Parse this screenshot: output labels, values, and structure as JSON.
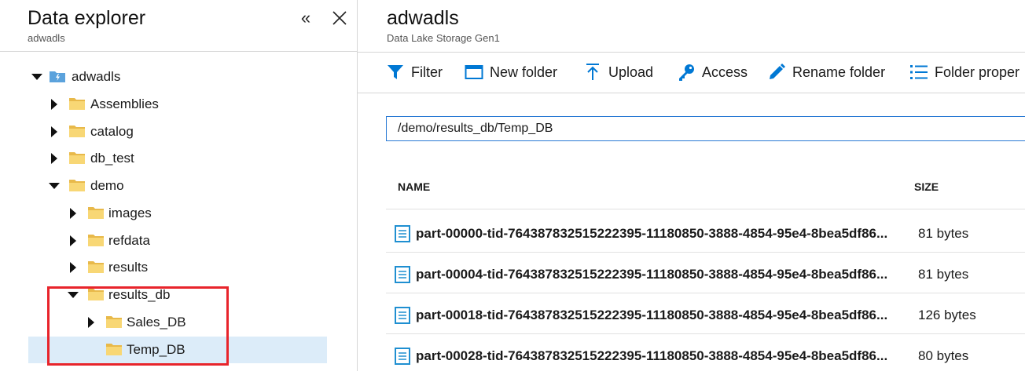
{
  "explorer": {
    "title": "Data explorer",
    "subtitle": "adwadls",
    "collapse_glyph": "«",
    "close_glyph": "✕",
    "tree": [
      {
        "label": "adwadls",
        "icon": "storage-account-icon",
        "state": "expanded"
      },
      {
        "label": "Assemblies",
        "icon": "folder-icon",
        "state": "collapsed"
      },
      {
        "label": "catalog",
        "icon": "folder-icon",
        "state": "collapsed"
      },
      {
        "label": "db_test",
        "icon": "folder-icon",
        "state": "collapsed"
      },
      {
        "label": "demo",
        "icon": "folder-icon",
        "state": "expanded"
      },
      {
        "label": "images",
        "icon": "folder-icon",
        "state": "collapsed"
      },
      {
        "label": "refdata",
        "icon": "folder-icon",
        "state": "collapsed"
      },
      {
        "label": "results",
        "icon": "folder-icon",
        "state": "collapsed"
      },
      {
        "label": "results_db",
        "icon": "folder-icon",
        "state": "expanded"
      },
      {
        "label": "Sales_DB",
        "icon": "folder-icon",
        "state": "collapsed"
      },
      {
        "label": "Temp_DB",
        "icon": "folder-icon",
        "state": "leaf",
        "selected": true
      }
    ]
  },
  "main": {
    "title": "adwadls",
    "subtitle": "Data Lake Storage Gen1",
    "toolbar": [
      {
        "label": "Filter",
        "icon": "filter-icon"
      },
      {
        "label": "New folder",
        "icon": "new-folder-icon"
      },
      {
        "label": "Upload",
        "icon": "upload-icon"
      },
      {
        "label": "Access",
        "icon": "key-icon"
      },
      {
        "label": "Rename folder",
        "icon": "pencil-icon"
      },
      {
        "label": "Folder proper",
        "icon": "list-icon"
      }
    ],
    "path": "/demo/results_db/Temp_DB",
    "columns": {
      "name": "NAME",
      "size": "SIZE"
    },
    "files": [
      {
        "name": "part-00000-tid-764387832515222395-11180850-3888-4854-95e4-8bea5df86...",
        "size": "81 bytes"
      },
      {
        "name": "part-00004-tid-764387832515222395-11180850-3888-4854-95e4-8bea5df86...",
        "size": "81 bytes"
      },
      {
        "name": "part-00018-tid-764387832515222395-11180850-3888-4854-95e4-8bea5df86...",
        "size": "126 bytes"
      },
      {
        "name": "part-00028-tid-764387832515222395-11180850-3888-4854-95e4-8bea5df86...",
        "size": "80 bytes"
      }
    ]
  },
  "colors": {
    "accent": "#0078d4",
    "folder": "#f8d775",
    "selected_row": "#dcecf9",
    "annotation": "#e8242b",
    "file_icon": "#1f8fd1"
  }
}
